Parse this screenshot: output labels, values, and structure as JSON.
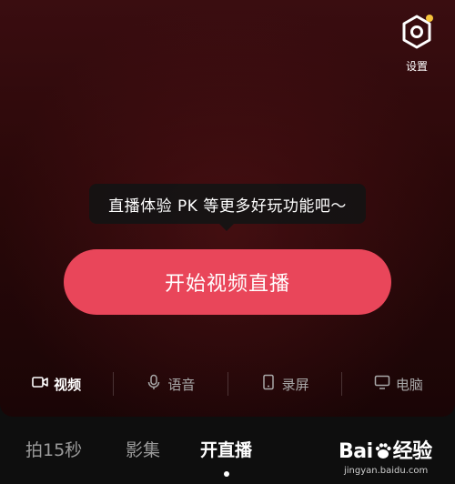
{
  "settings": {
    "label": "设置",
    "icon": "hexagon-settings-icon",
    "badge_color": "#f5c33b"
  },
  "tooltip": {
    "text": "直播体验 PK 等更多好玩功能吧～"
  },
  "start_button": {
    "label": "开始视频直播",
    "color": "#e9465a"
  },
  "modes": [
    {
      "label": "视频",
      "icon": "video-camera-icon",
      "active": true
    },
    {
      "label": "语音",
      "icon": "microphone-icon",
      "active": false
    },
    {
      "label": "录屏",
      "icon": "phone-screen-icon",
      "active": false
    },
    {
      "label": "电脑",
      "icon": "monitor-icon",
      "active": false
    }
  ],
  "bottom_tabs": [
    {
      "label": "拍15秒",
      "active": false
    },
    {
      "label": "影集",
      "active": false
    },
    {
      "label": "开直播",
      "active": true
    }
  ],
  "watermark": {
    "logo_text_left": "Bai",
    "logo_text_right": "经验",
    "site": "jingyan.baidu.com"
  }
}
